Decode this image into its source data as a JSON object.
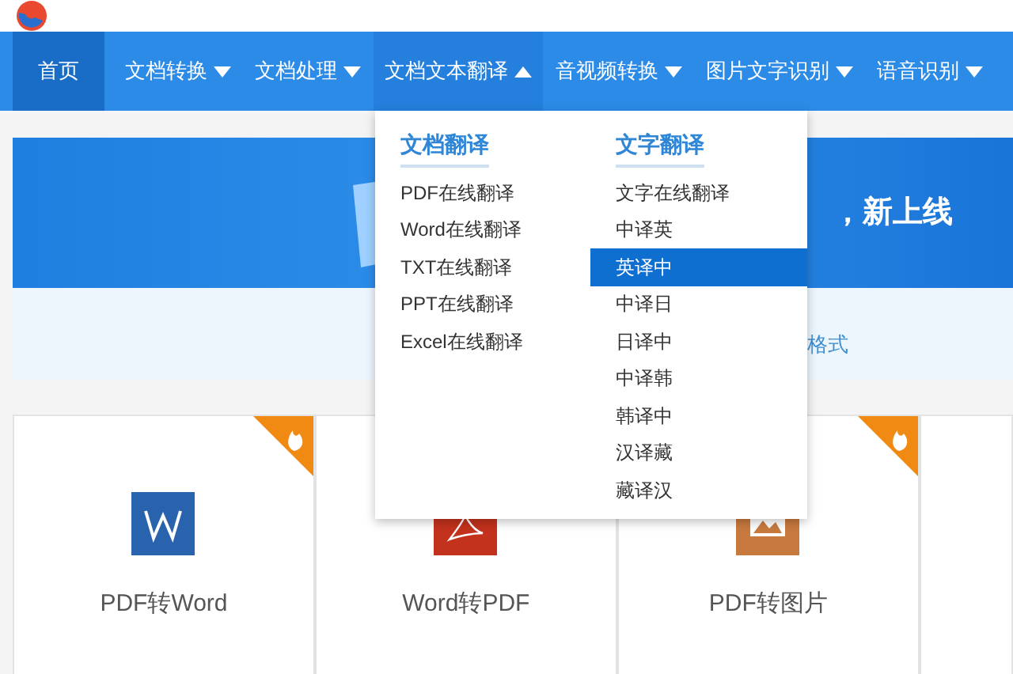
{
  "nav": {
    "items": [
      {
        "label": "首页",
        "selected": true,
        "has_menu": false,
        "expanded": false
      },
      {
        "label": "文档转换",
        "selected": false,
        "has_menu": true,
        "expanded": false
      },
      {
        "label": "文档处理",
        "selected": false,
        "has_menu": true,
        "expanded": false
      },
      {
        "label": "文档文本翻译",
        "selected": false,
        "has_menu": true,
        "expanded": true
      },
      {
        "label": "音视频转换",
        "selected": false,
        "has_menu": true,
        "expanded": false
      },
      {
        "label": "图片文字识别",
        "selected": false,
        "has_menu": true,
        "expanded": false
      },
      {
        "label": "语音识别",
        "selected": false,
        "has_menu": true,
        "expanded": false
      }
    ]
  },
  "dropdown": {
    "columns": [
      {
        "heading": "文档翻译",
        "items": [
          {
            "label": "PDF在线翻译",
            "selected": false
          },
          {
            "label": "Word在线翻译",
            "selected": false
          },
          {
            "label": "TXT在线翻译",
            "selected": false
          },
          {
            "label": "PPT在线翻译",
            "selected": false
          },
          {
            "label": "Excel在线翻译",
            "selected": false
          }
        ]
      },
      {
        "heading": "文字翻译",
        "items": [
          {
            "label": "文字在线翻译",
            "selected": false
          },
          {
            "label": "中译英",
            "selected": false
          },
          {
            "label": "英译中",
            "selected": true
          },
          {
            "label": "中译日",
            "selected": false
          },
          {
            "label": "日译中",
            "selected": false
          },
          {
            "label": "中译韩",
            "selected": false
          },
          {
            "label": "韩译中",
            "selected": false
          },
          {
            "label": "汉译藏",
            "selected": false
          },
          {
            "label": "藏译汉",
            "selected": false
          }
        ]
      }
    ]
  },
  "banner": {
    "text": "，新上线"
  },
  "notice": {
    "text": "格式"
  },
  "cards": [
    {
      "label": "PDF转Word",
      "kind": "word",
      "hot": true
    },
    {
      "label": "Word转PDF",
      "kind": "pdf"
    },
    {
      "label": "PDF转图片",
      "kind": "image",
      "hot": true
    }
  ]
}
